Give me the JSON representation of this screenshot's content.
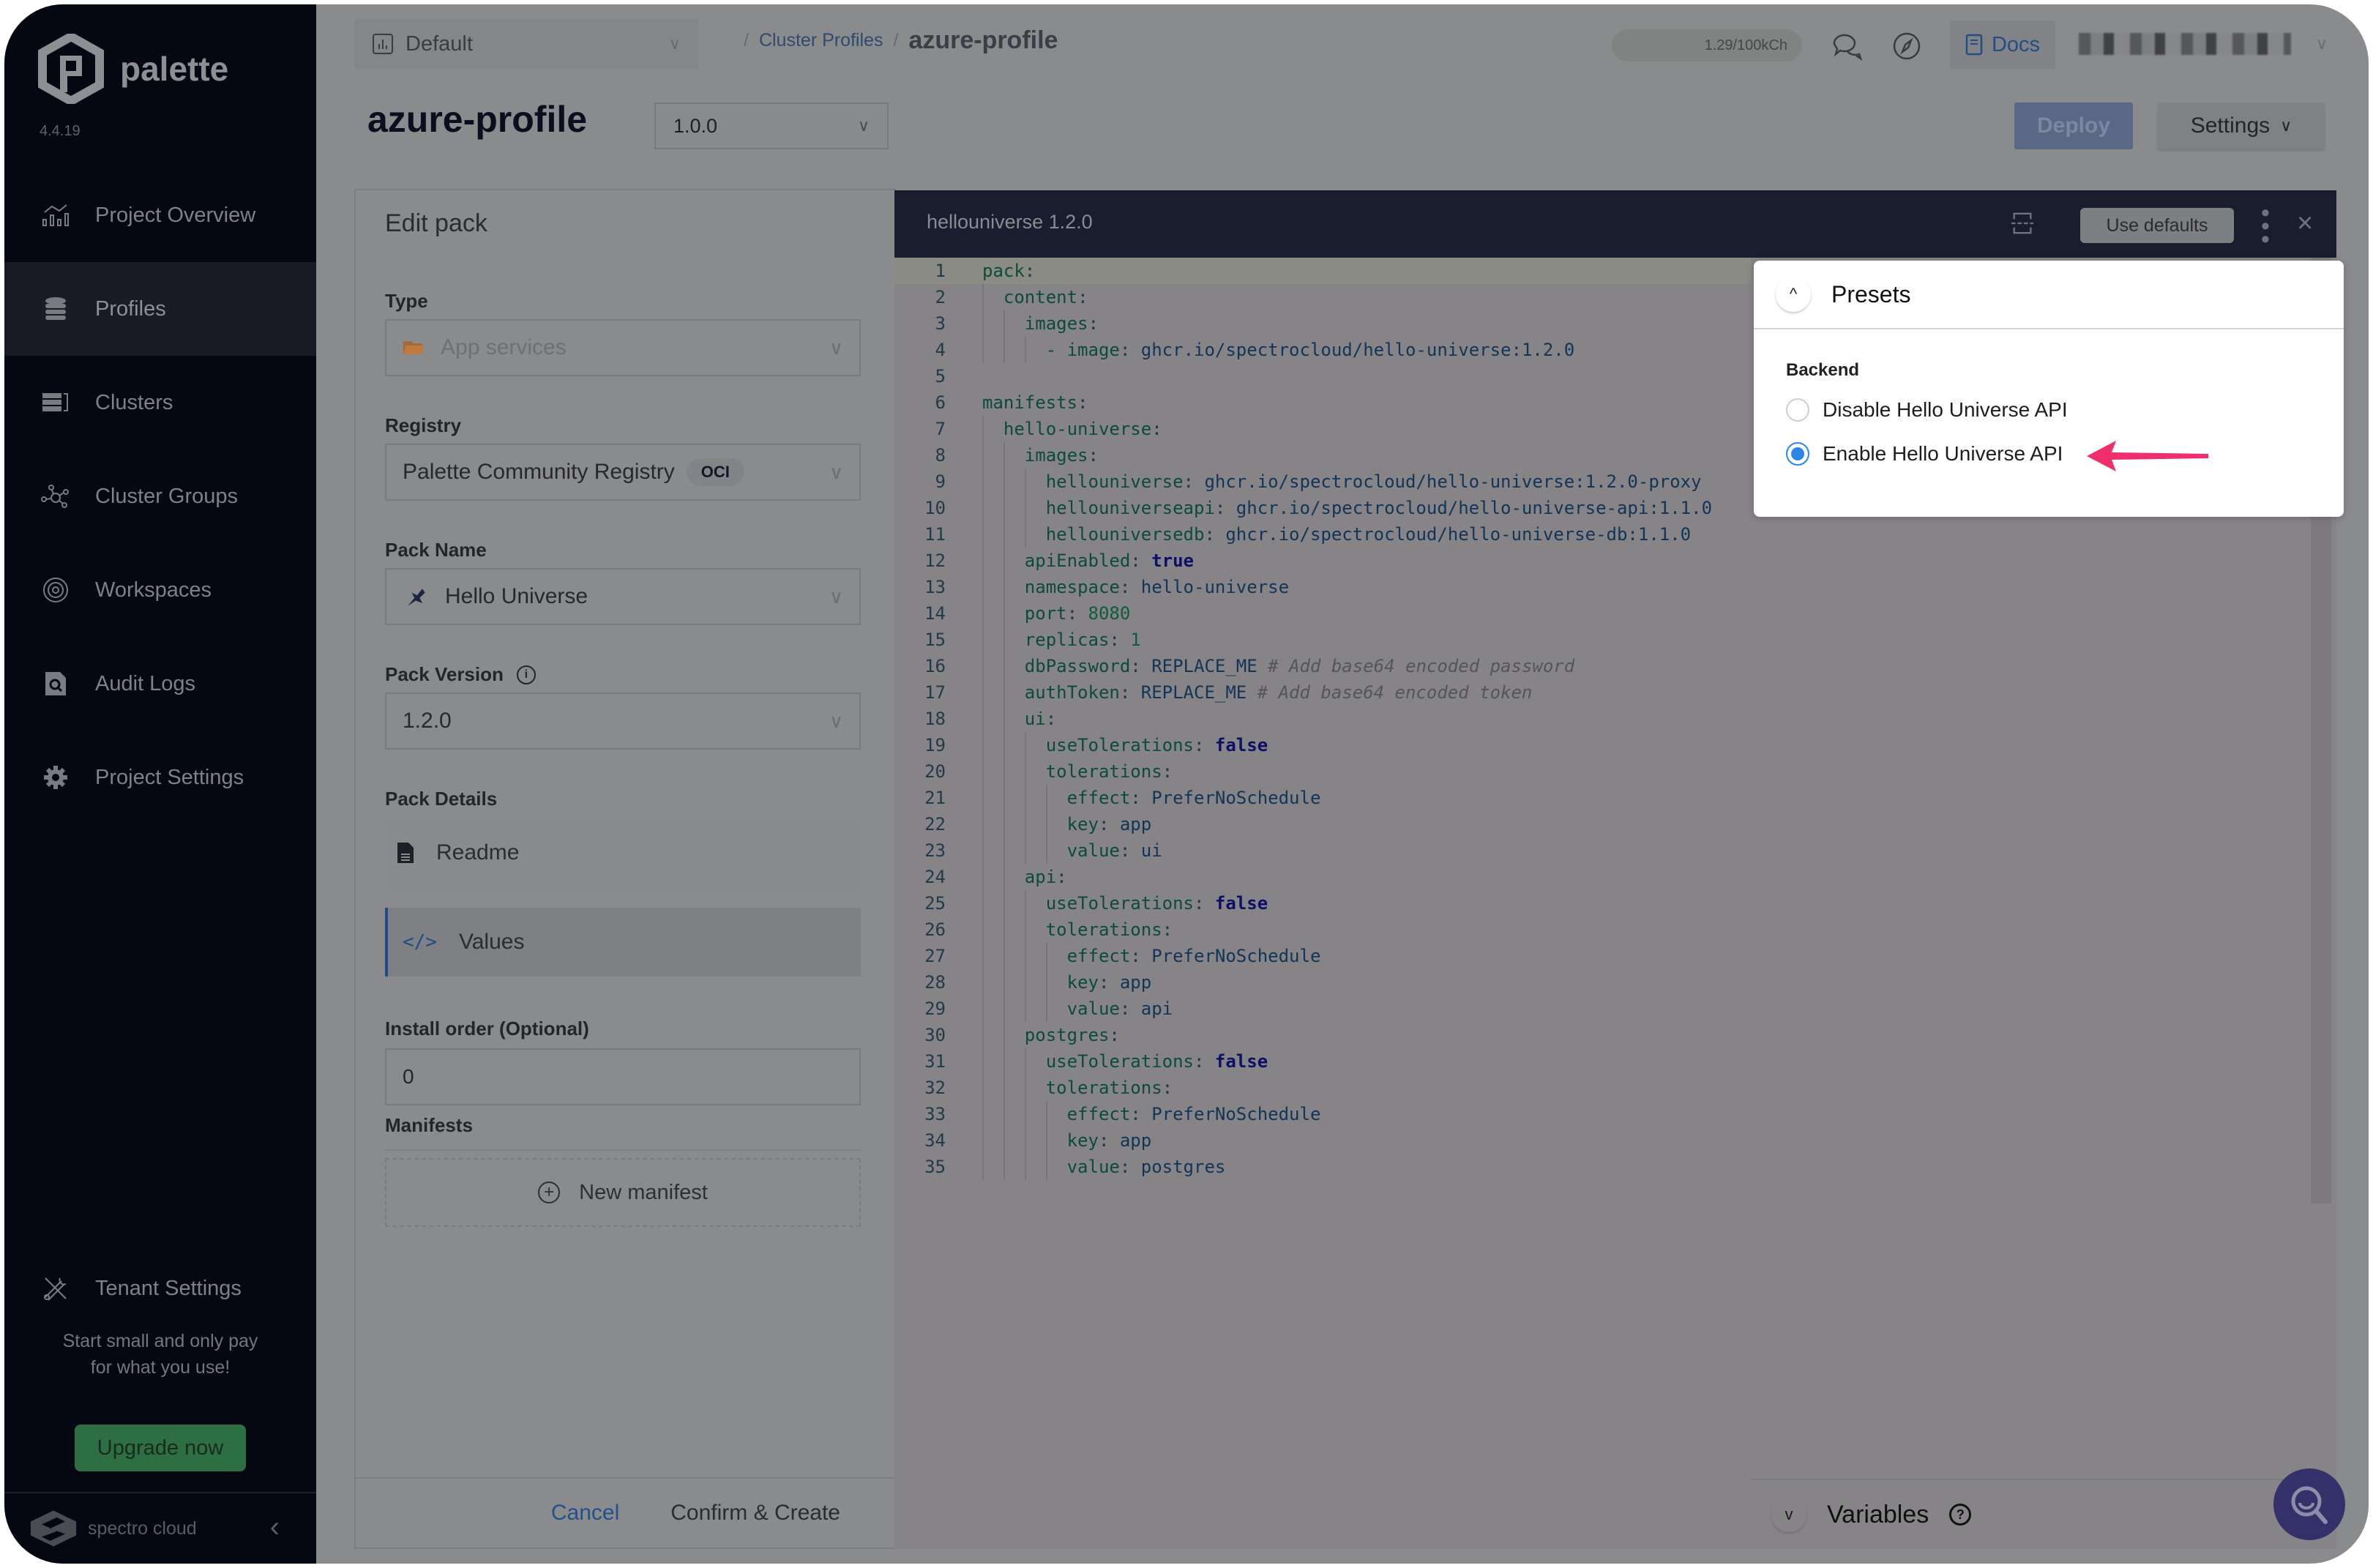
{
  "app": {
    "name": "palette",
    "version": "4.4.19"
  },
  "sidebar": {
    "items": [
      {
        "label": "Project Overview",
        "icon": "chart-overview-icon",
        "active": false
      },
      {
        "label": "Profiles",
        "icon": "database-stack-icon",
        "active": true
      },
      {
        "label": "Clusters",
        "icon": "server-rack-icon",
        "active": false
      },
      {
        "label": "Cluster Groups",
        "icon": "network-nodes-icon",
        "active": false
      },
      {
        "label": "Workspaces",
        "icon": "workspace-orbit-icon",
        "active": false
      },
      {
        "label": "Audit Logs",
        "icon": "audit-search-icon",
        "active": false
      },
      {
        "label": "Project Settings",
        "icon": "gear-icon",
        "active": false
      }
    ],
    "tenant_settings": "Tenant Settings",
    "promo_line1": "Start small and only pay",
    "promo_line2": "for what you use!",
    "upgrade_label": "Upgrade now",
    "footer_brand": "spectro cloud"
  },
  "topbar": {
    "project": "Default",
    "breadcrumb": {
      "parent": "Cluster Profiles",
      "current": "azure-profile"
    },
    "usage": "1.29/100kCh",
    "docs_label": "Docs"
  },
  "header": {
    "title": "azure-profile",
    "version": "1.0.0",
    "deploy_label": "Deploy",
    "settings_label": "Settings"
  },
  "edit_pack": {
    "title": "Edit pack",
    "type_label": "Type",
    "type_value": "App services",
    "registry_label": "Registry",
    "registry_value": "Palette Community Registry",
    "registry_badge": "OCI",
    "pack_name_label": "Pack Name",
    "pack_name_value": "Hello Universe",
    "pack_version_label": "Pack Version",
    "pack_version_value": "1.2.0",
    "pack_details_label": "Pack Details",
    "details": [
      {
        "label": "Readme",
        "active": false
      },
      {
        "label": "Values",
        "active": true
      }
    ],
    "install_order_label": "Install order (Optional)",
    "install_order_value": "0",
    "manifests_label": "Manifests",
    "new_manifest_label": "New manifest",
    "cancel_label": "Cancel",
    "confirm_label": "Confirm & Create"
  },
  "editor": {
    "title": "hellouniverse 1.2.0",
    "use_defaults_label": "Use defaults",
    "lines": [
      {
        "indent": 0,
        "key": "pack",
        "value": "",
        "vtype": ""
      },
      {
        "indent": 1,
        "key": "content",
        "value": "",
        "vtype": ""
      },
      {
        "indent": 2,
        "key": "images",
        "value": "",
        "vtype": ""
      },
      {
        "indent": 3,
        "key": "- image",
        "value": "ghcr.io/spectrocloud/hello-universe:1.2.0",
        "vtype": "v"
      },
      {
        "indent": 0,
        "key": "",
        "value": "",
        "vtype": ""
      },
      {
        "indent": 0,
        "key": "manifests",
        "value": "",
        "vtype": ""
      },
      {
        "indent": 1,
        "key": "hello-universe",
        "value": "",
        "vtype": ""
      },
      {
        "indent": 2,
        "key": "images",
        "value": "",
        "vtype": ""
      },
      {
        "indent": 3,
        "key": "hellouniverse",
        "value": "ghcr.io/spectrocloud/hello-universe:1.2.0-proxy",
        "vtype": "v"
      },
      {
        "indent": 3,
        "key": "hellouniverseapi",
        "value": "ghcr.io/spectrocloud/hello-universe-api:1.1.0",
        "vtype": "v"
      },
      {
        "indent": 3,
        "key": "hellouniversedb",
        "value": "ghcr.io/spectrocloud/hello-universe-db:1.1.0",
        "vtype": "v"
      },
      {
        "indent": 2,
        "key": "apiEnabled",
        "value": "true",
        "vtype": "b"
      },
      {
        "indent": 2,
        "key": "namespace",
        "value": "hello-universe",
        "vtype": "v"
      },
      {
        "indent": 2,
        "key": "port",
        "value": "8080",
        "vtype": "n"
      },
      {
        "indent": 2,
        "key": "replicas",
        "value": "1",
        "vtype": "n"
      },
      {
        "indent": 2,
        "key": "dbPassword",
        "value": "REPLACE_ME",
        "vtype": "v",
        "comment": "# Add base64 encoded password"
      },
      {
        "indent": 2,
        "key": "authToken",
        "value": "REPLACE_ME",
        "vtype": "v",
        "comment": "# Add base64 encoded token"
      },
      {
        "indent": 2,
        "key": "ui",
        "value": "",
        "vtype": ""
      },
      {
        "indent": 3,
        "key": "useTolerations",
        "value": "false",
        "vtype": "b"
      },
      {
        "indent": 3,
        "key": "tolerations",
        "value": "",
        "vtype": ""
      },
      {
        "indent": 4,
        "key": "effect",
        "value": "PreferNoSchedule",
        "vtype": "v"
      },
      {
        "indent": 4,
        "key": "key",
        "value": "app",
        "vtype": "v"
      },
      {
        "indent": 4,
        "key": "value",
        "value": "ui",
        "vtype": "v"
      },
      {
        "indent": 2,
        "key": "api",
        "value": "",
        "vtype": ""
      },
      {
        "indent": 3,
        "key": "useTolerations",
        "value": "false",
        "vtype": "b"
      },
      {
        "indent": 3,
        "key": "tolerations",
        "value": "",
        "vtype": ""
      },
      {
        "indent": 4,
        "key": "effect",
        "value": "PreferNoSchedule",
        "vtype": "v"
      },
      {
        "indent": 4,
        "key": "key",
        "value": "app",
        "vtype": "v"
      },
      {
        "indent": 4,
        "key": "value",
        "value": "api",
        "vtype": "v"
      },
      {
        "indent": 2,
        "key": "postgres",
        "value": "",
        "vtype": ""
      },
      {
        "indent": 3,
        "key": "useTolerations",
        "value": "false",
        "vtype": "b"
      },
      {
        "indent": 3,
        "key": "tolerations",
        "value": "",
        "vtype": ""
      },
      {
        "indent": 4,
        "key": "effect",
        "value": "PreferNoSchedule",
        "vtype": "v"
      },
      {
        "indent": 4,
        "key": "key",
        "value": "app",
        "vtype": "v"
      },
      {
        "indent": 4,
        "key": "value",
        "value": "postgres",
        "vtype": "v"
      }
    ]
  },
  "presets": {
    "title": "Presets",
    "group_label": "Backend",
    "options": [
      {
        "label": "Disable Hello Universe API",
        "checked": false
      },
      {
        "label": "Enable Hello Universe API",
        "checked": true
      }
    ],
    "annotation_color": "#ee2f6b"
  },
  "variables": {
    "title": "Variables"
  }
}
